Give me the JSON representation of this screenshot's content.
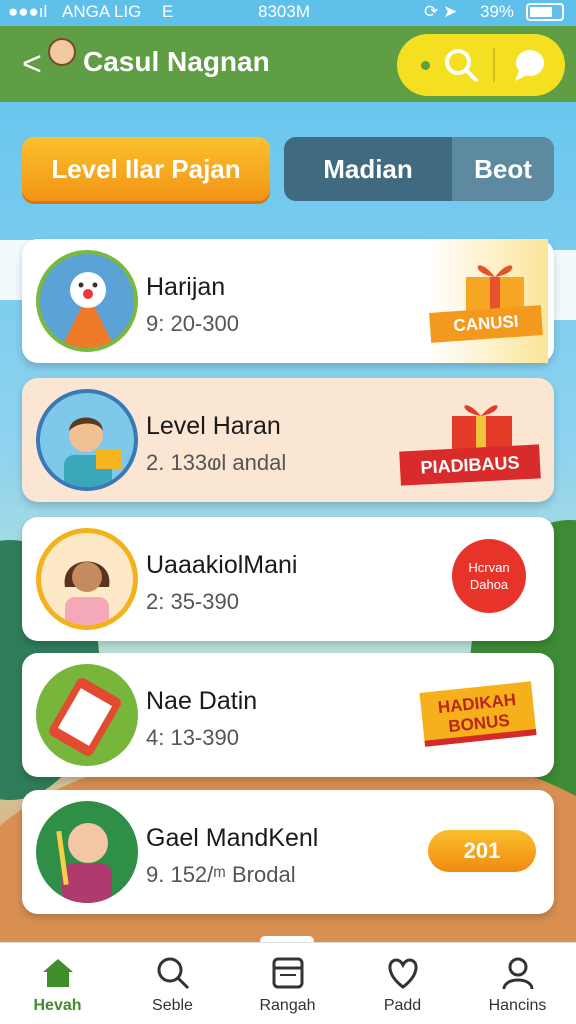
{
  "status": {
    "carrier": "ANGA LIG",
    "net": "E",
    "time": "8303M",
    "battery": "39%"
  },
  "header": {
    "title": "Casul Nagnan",
    "back_label": "<"
  },
  "tabs": [
    {
      "label": "Level Ilar Pajan"
    },
    {
      "label": "Madian"
    },
    {
      "label": "Beot"
    }
  ],
  "cards": [
    {
      "name": "Harijan",
      "range": "9: 20-300",
      "badge": "CANUSI"
    },
    {
      "name": "Level Haran",
      "range": "2. 133ⱷl andal",
      "badge": "PIADIBAUS"
    },
    {
      "name": "UaaakiolMani",
      "range": "2: 35-390",
      "badge": "Hcrvan Dahoa"
    },
    {
      "name": "Nae Datin",
      "range": "4: 13-390",
      "badge": "HADIKAH BONUS"
    },
    {
      "name": "Gael MandKenl",
      "range": "9. 152/ᵐ Brodal",
      "badge": "201"
    }
  ],
  "nav": [
    {
      "label": "Hevah",
      "icon": "home-icon"
    },
    {
      "label": "Seble",
      "icon": "search-icon"
    },
    {
      "label": "Rangah",
      "icon": "ledger-icon"
    },
    {
      "label": "Padd",
      "icon": "heart-icon"
    },
    {
      "label": "Hancins",
      "icon": "profile-icon"
    }
  ],
  "colors": {
    "header": "#5f9e45",
    "accent": "#f4e021",
    "tab_active": "#f6a81c",
    "nav_active": "#3e8e2c"
  }
}
